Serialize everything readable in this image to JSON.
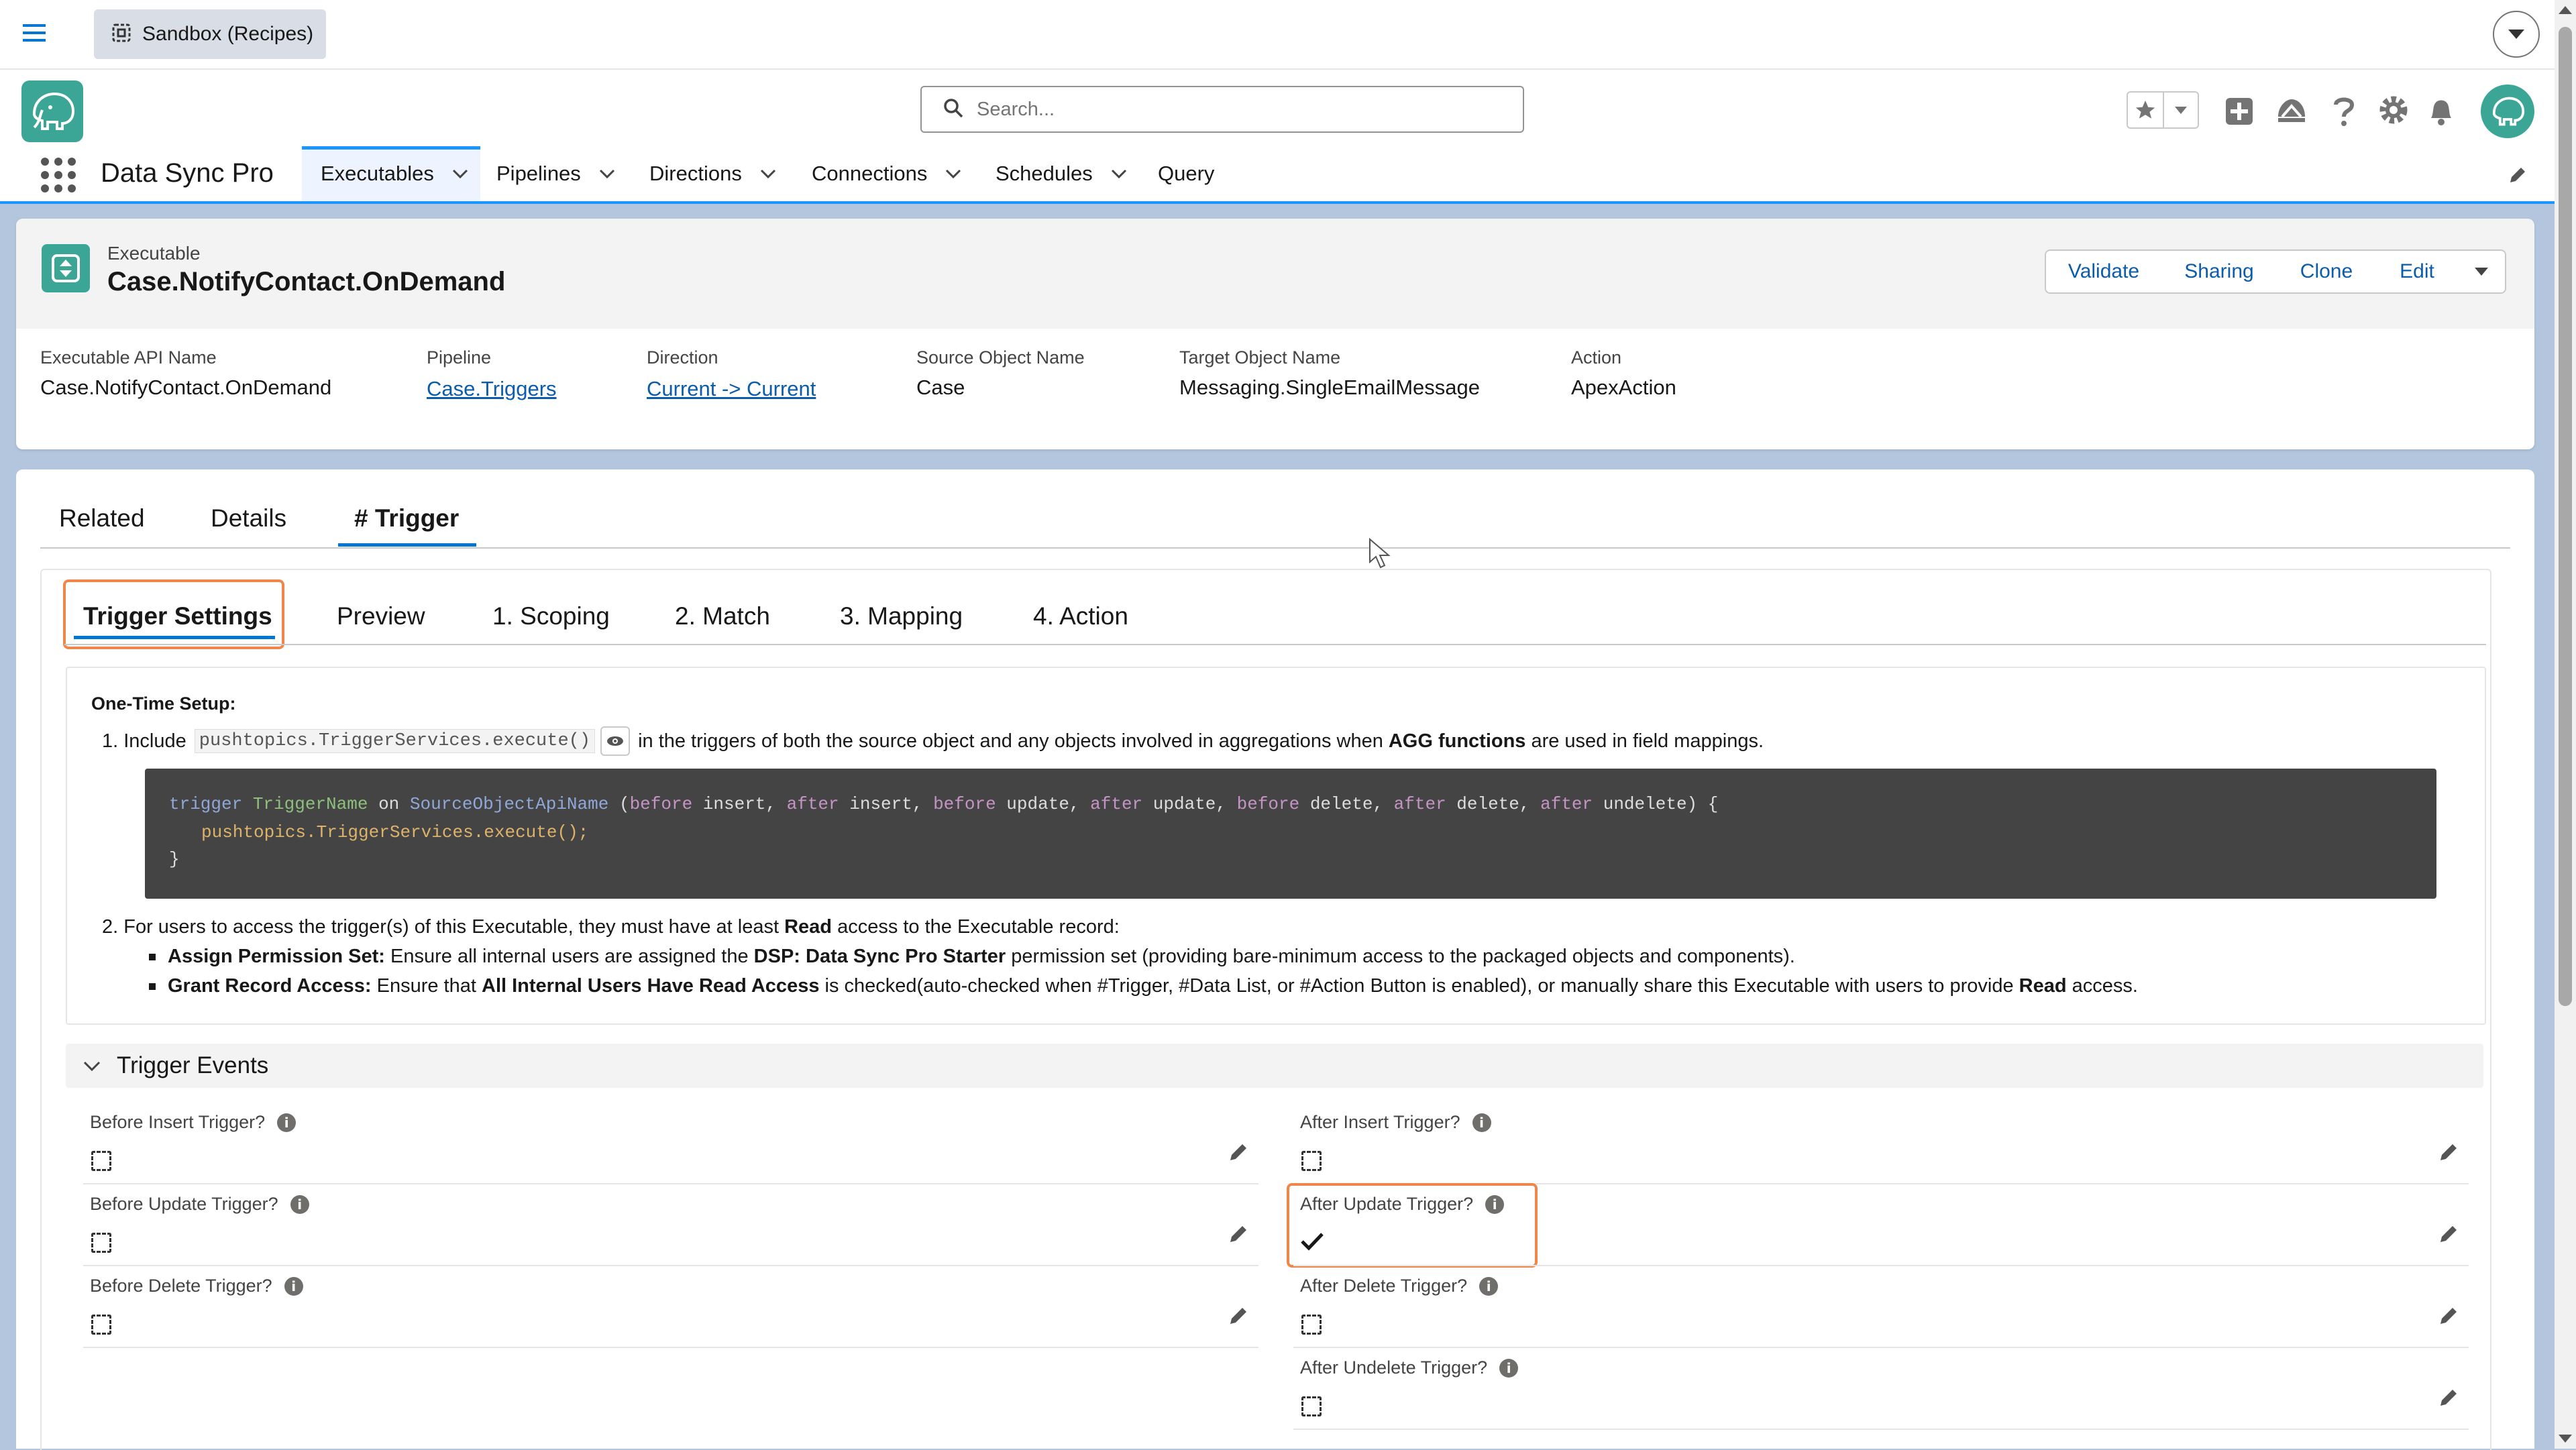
{
  "app": {
    "sandbox_label": "Sandbox (Recipes)",
    "app_name": "Data Sync Pro",
    "search_placeholder": "Search..."
  },
  "nav": {
    "tabs": [
      {
        "label": "Executables"
      },
      {
        "label": "Pipelines"
      },
      {
        "label": "Directions"
      },
      {
        "label": "Connections"
      },
      {
        "label": "Schedules"
      },
      {
        "label": "Query"
      }
    ]
  },
  "record": {
    "object_label": "Executable",
    "title": "Case.NotifyContact.OnDemand",
    "actions": [
      "Validate",
      "Sharing",
      "Clone",
      "Edit"
    ],
    "fields": [
      {
        "label": "Executable API Name",
        "value": "Case.NotifyContact.OnDemand"
      },
      {
        "label": "Pipeline",
        "value": "Case.Triggers"
      },
      {
        "label": "Direction",
        "value": "Current -> Current"
      },
      {
        "label": "Source Object Name",
        "value": "Case"
      },
      {
        "label": "Target Object Name",
        "value": "Messaging.SingleEmailMessage"
      },
      {
        "label": "Action",
        "value": "ApexAction"
      }
    ]
  },
  "record_tabs": [
    "Related",
    "Details",
    "# Trigger"
  ],
  "sub_tabs": [
    "Trigger Settings",
    "Preview",
    "1. Scoping",
    "2. Match",
    "3. Mapping",
    "4. Action"
  ],
  "setup": {
    "heading": "One-Time Setup:",
    "step1_prefix": "1. Include",
    "step1_code": "pushtopics.TriggerServices.execute()",
    "step1_mid": "in the triggers of both the source object and any objects involved in aggregations when",
    "step1_bold": "AGG functions",
    "step1_suffix": "are used in field mappings.",
    "code_line1": "trigger TriggerName on SourceObjectApiName (before insert, after insert, before update, after update, before delete, after delete, after undelete) {",
    "code_line2": "pushtopics.TriggerServices.execute();",
    "code_line3": "}",
    "step2_prefix": "2. For users to access the trigger(s) of this Executable, they must have at least",
    "step2_bold": "Read",
    "step2_suffix": "access to the Executable record:",
    "b1_title": "Assign Permission Set:",
    "b1_text": "Ensure all internal users are assigned the",
    "b1_bold": "DSP: Data Sync Pro Starter",
    "b1_suffix": "permission set (providing bare-minimum access to the packaged objects and components).",
    "b2_title": "Grant Record Access:",
    "b2_text": "Ensure that",
    "b2_bold": "All Internal Users Have Read Access",
    "b2_mid": "is checked(auto-checked when #Trigger, #Data List, or #Action Button is enabled), or manually share this Executable with users to provide",
    "b2_bold2": "Read",
    "b2_suffix": "access."
  },
  "trigger_events": {
    "heading": "Trigger Events",
    "left": [
      {
        "label": "Before Insert Trigger?",
        "checked": false
      },
      {
        "label": "Before Update Trigger?",
        "checked": false
      },
      {
        "label": "Before Delete Trigger?",
        "checked": false
      }
    ],
    "right": [
      {
        "label": "After Insert Trigger?",
        "checked": false
      },
      {
        "label": "After Update Trigger?",
        "checked": true
      },
      {
        "label": "After Delete Trigger?",
        "checked": false
      },
      {
        "label": "After Undelete Trigger?",
        "checked": false
      }
    ]
  },
  "colors": {
    "brand": "#0b5cab",
    "highlight": "#f0874a",
    "app_icon": "#3ba696"
  }
}
